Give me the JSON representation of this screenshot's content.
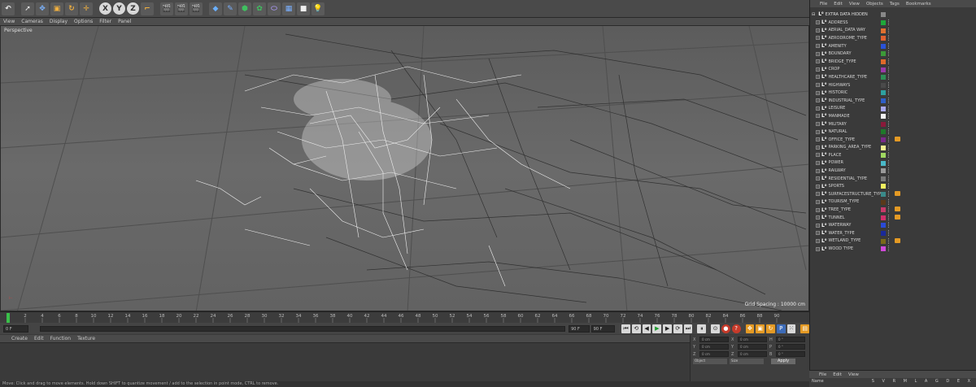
{
  "viewport": {
    "menu": [
      "View",
      "Cameras",
      "Display",
      "Options",
      "Filter",
      "Panel"
    ],
    "camera_label": "Perspective",
    "grid_spacing": "Grid Spacing : 10000 cm"
  },
  "timeline": {
    "ticks": [
      "0",
      "2",
      "4",
      "6",
      "8",
      "10",
      "12",
      "14",
      "16",
      "18",
      "20",
      "22",
      "24",
      "26",
      "28",
      "30",
      "32",
      "34",
      "36",
      "38",
      "40",
      "42",
      "44",
      "46",
      "48",
      "50",
      "52",
      "54",
      "56",
      "58",
      "60",
      "62",
      "64",
      "66",
      "68",
      "70",
      "72",
      "74",
      "76",
      "78",
      "80",
      "82",
      "84",
      "86",
      "88",
      "90"
    ],
    "start_frame": "0 F",
    "current_frame": "0 F",
    "min_frame": "90 F",
    "end_frame": "90 F"
  },
  "material_menu": [
    "Create",
    "Edit",
    "Function",
    "Texture"
  ],
  "coords": {
    "rows": [
      {
        "a": "X",
        "av": "0 cm",
        "b": "X",
        "bv": "0 cm",
        "c": "H",
        "cv": "0 °"
      },
      {
        "a": "Y",
        "av": "0 cm",
        "b": "Y",
        "bv": "0 cm",
        "c": "P",
        "cv": "0 °"
      },
      {
        "a": "Z",
        "av": "0 cm",
        "b": "Z",
        "bv": "0 cm",
        "c": "B",
        "cv": "0 °"
      }
    ],
    "mode": "Object",
    "size_mode": "Size",
    "apply": "Apply"
  },
  "status_text": "Move: Click and drag to move elements. Hold down SHIFT to quantize movement / add to the selection in point mode, CTRL to remove.",
  "object_manager": {
    "menu": [
      "File",
      "Edit",
      "View",
      "Objects",
      "Tags",
      "Bookmarks"
    ],
    "root": "EXTRA DATA HIDDEN",
    "items": [
      {
        "name": "ADDRESS",
        "color": "#1fa83a",
        "tag": false
      },
      {
        "name": "AERIAL_DATA WAY",
        "color": "#e07030",
        "tag": false
      },
      {
        "name": "AERODROME_TYPE",
        "color": "#e06030",
        "tag": false
      },
      {
        "name": "AMENITY",
        "color": "#2a52d8",
        "tag": false
      },
      {
        "name": "BOUNDARY",
        "color": "#3c9a38",
        "tag": false
      },
      {
        "name": "BRIDGE_TYPE",
        "color": "#e06a2a",
        "tag": false
      },
      {
        "name": "CROP",
        "color": "#9a3aaa",
        "tag": false
      },
      {
        "name": "HEALTHCARE_TYPE",
        "color": "#2f8f55",
        "tag": false
      },
      {
        "name": "HIGHWAYS",
        "color": "#4a4a4a",
        "tag": false
      },
      {
        "name": "HISTORIC",
        "color": "#2ea0a0",
        "tag": false
      },
      {
        "name": "INDUSTRIAL_TYPE",
        "color": "#2f5fc8",
        "tag": false
      },
      {
        "name": "LEISURE",
        "color": "#a9a9ee",
        "tag": false
      },
      {
        "name": "MANMADE",
        "color": "#f2f2f2",
        "tag": false
      },
      {
        "name": "MILITARY",
        "color": "#8a1a3a",
        "tag": false
      },
      {
        "name": "NATURAL",
        "color": "#1f7a2a",
        "tag": false
      },
      {
        "name": "OFFICE_TYPE",
        "color": "#7a2a8a",
        "tag": true
      },
      {
        "name": "PARKING_AREA_TYPE",
        "color": "#f0f090",
        "tag": false
      },
      {
        "name": "PLACE",
        "color": "#a0d860",
        "tag": false
      },
      {
        "name": "POWER",
        "color": "#4ab8c8",
        "tag": false
      },
      {
        "name": "RAILWAY",
        "color": "#9a9a9a",
        "tag": false
      },
      {
        "name": "RESIDENTIAL_TYPE",
        "color": "#7a7a7a",
        "tag": false
      },
      {
        "name": "SPORTS",
        "color": "#f0f060",
        "tag": false
      },
      {
        "name": "SURFACESTRUCTURE_TYPE",
        "color": "#3a8a8a",
        "tag": true
      },
      {
        "name": "TOURISM_TYPE",
        "color": "#5a3a1a",
        "tag": false
      },
      {
        "name": "TREE_TYPE",
        "color": "#c83a6a",
        "tag": true
      },
      {
        "name": "TUNNEL",
        "color": "#d0306a",
        "tag": true
      },
      {
        "name": "WATERWAY",
        "color": "#2a4ad8",
        "tag": false
      },
      {
        "name": "WATER_TYPE",
        "color": "#1a2a9a",
        "tag": false
      },
      {
        "name": "WETLAND_TYPE",
        "color": "#7a6a1a",
        "tag": true
      },
      {
        "name": "WOOD TYPE",
        "color": "#d04ad8",
        "tag": false
      }
    ]
  },
  "attributes": {
    "menu": [
      "File",
      "Edit",
      "View"
    ],
    "name_label": "Name",
    "columns": "S V R M L A G D E X"
  }
}
